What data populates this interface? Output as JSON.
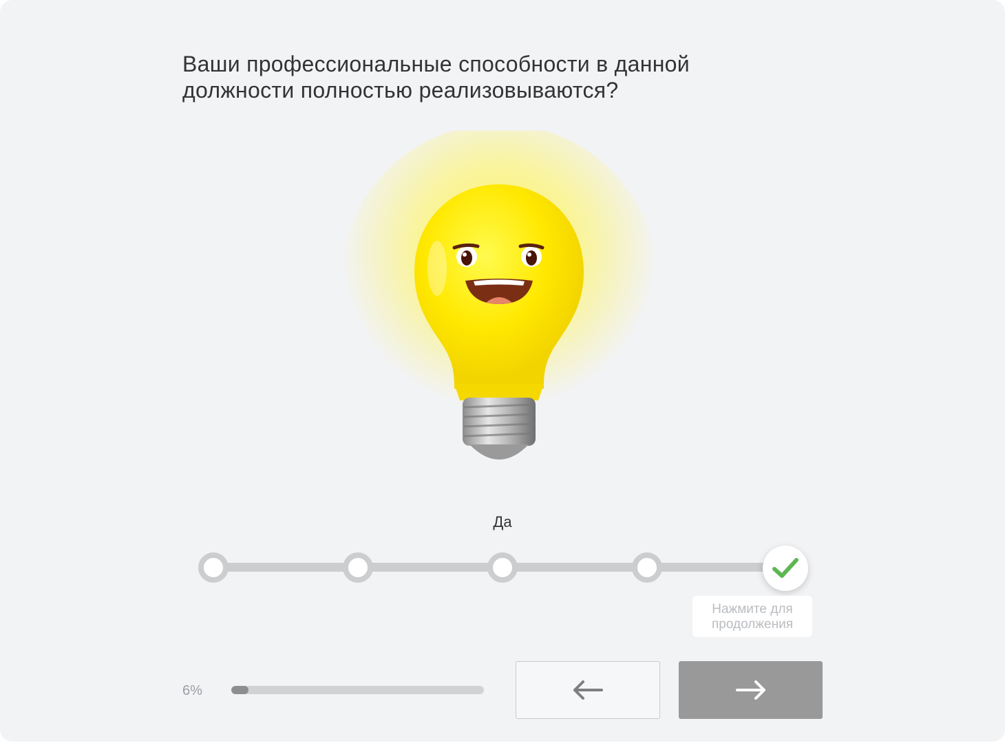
{
  "question": {
    "line1": "Ваши профессиональные способности в данной",
    "line2": "должности полностью реализовываются?"
  },
  "illustration": {
    "icon": "smiling-light-bulb-icon",
    "glow_color": "#ffef1a"
  },
  "answer": {
    "selected_label": "Да",
    "scale_points": 5,
    "selected_index": 5
  },
  "continue_hint": {
    "line1": "Нажмите для",
    "line2": "продолжения"
  },
  "progress": {
    "label": "6%",
    "value": 0.06
  },
  "nav": {
    "back_icon": "arrow-left-icon",
    "next_icon": "arrow-right-icon"
  },
  "colors": {
    "check": "#5fb654",
    "next_button": "#999999",
    "track": "#cccdcf"
  }
}
